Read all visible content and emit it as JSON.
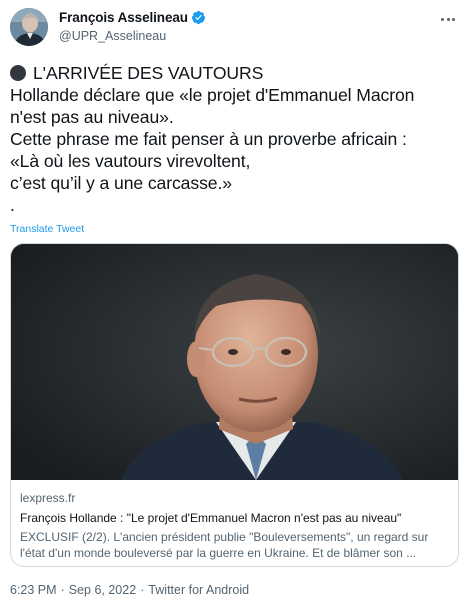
{
  "tweet": {
    "author": {
      "display_name": "François Asselineau",
      "handle": "@UPR_Asselineau",
      "verified_icon": "verified-badge-icon"
    },
    "more_icon": "more-options-icon",
    "text_lines": [
      "L'ARRIVÉE DES VAUTOURS",
      "Hollande déclare que «le projet d'Emmanuel Macron",
      "n'est pas au niveau».",
      "Cette phrase me fait penser à un proverbe africain :",
      "«Là où les vautours virevoltent,",
      "c’est qu’il y a une carcasse.»",
      "."
    ],
    "translate_label": "Translate Tweet",
    "card": {
      "domain": "lexpress.fr",
      "title": "François Hollande : \"Le projet d'Emmanuel Macron n'est pas au niveau\"",
      "description_lines": [
        "EXCLUSIF (2/2). L'ancien président publie \"Bouleversements\", un regard sur",
        "l'état d'un monde bouleversé par la guerre en Ukraine. Et de blâmer son ..."
      ]
    },
    "meta": {
      "time": "6:23 PM",
      "date": "Sep 6, 2022",
      "source": "Twitter for Android",
      "separator": "·"
    },
    "colors": {
      "link": "#1d9bf0",
      "secondary_text": "#536471",
      "primary_text": "#0f1419",
      "border": "#cfd9de"
    }
  }
}
